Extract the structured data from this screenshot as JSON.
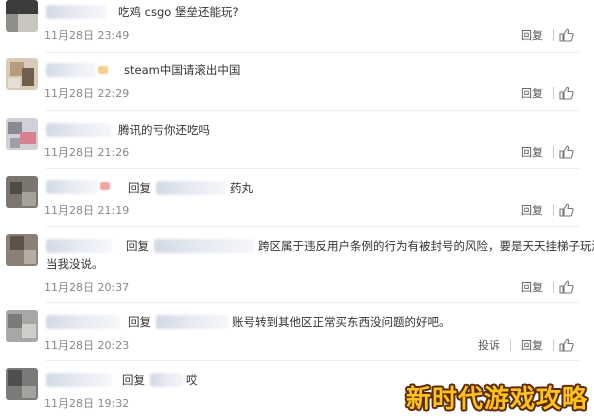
{
  "comments": [
    {
      "text": "吃鸡 csgo 堡垒还能玩?",
      "time": "11月28日 23:49",
      "reply": "回复"
    },
    {
      "text": "steam中国请滚出中国",
      "time": "11月28日 22:29",
      "reply": "回复"
    },
    {
      "text": "腾讯的亏你还吃吗",
      "time": "11月28日 21:26",
      "reply": "回复"
    },
    {
      "prefix": "回复",
      "text": "药丸",
      "time": "11月28日 21:19",
      "reply": "回复"
    },
    {
      "prefix": "回复",
      "text": "跨区属于违反用户条例的行为有被封号的风险，要是天天挂梯子玩游戏",
      "text2": "当我没说。",
      "time": "11月28日 20:37",
      "reply": "回复"
    },
    {
      "prefix": "回复",
      "text": "账号转到其他区正常买东西没问题的好吧。",
      "time": "11月28日 20:23",
      "reply": "回复",
      "report": "投诉"
    },
    {
      "prefix": "回复",
      "text": "哎",
      "time": "11月28日 19:32"
    }
  ],
  "icons": {
    "like": "thumbs-up-icon"
  },
  "watermark": "新时代游戏攻略",
  "colors": {
    "watermark_fill": "#ffc21a",
    "watermark_outline": "#5a2b08",
    "meta_text": "#888888"
  }
}
